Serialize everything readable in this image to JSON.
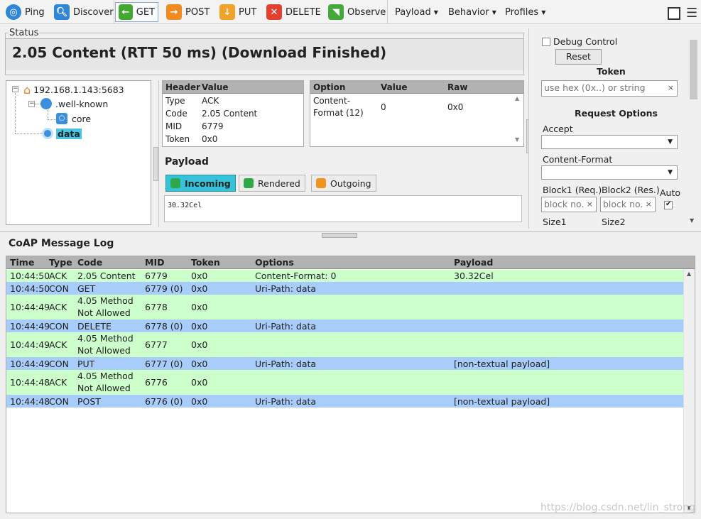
{
  "toolbar": {
    "ping": "Ping",
    "discover": "Discover",
    "get": "GET",
    "post": "POST",
    "put": "PUT",
    "delete": "DELETE",
    "observe": "Observe",
    "menus": {
      "payload": "Payload",
      "behavior": "Behavior",
      "profiles": "Profiles"
    }
  },
  "status": {
    "legend": "Status",
    "text": "2.05 Content (RTT 50 ms) (Download Finished)"
  },
  "tree": {
    "root": "192.168.1.143:5683",
    "well_known": ".well-known",
    "core": "core",
    "data": "data"
  },
  "header_table": {
    "col_header": "Header",
    "col_value": "Value",
    "rows": [
      {
        "k": "Type",
        "v": "ACK"
      },
      {
        "k": "Code",
        "v": "2.05 Content"
      },
      {
        "k": "MID",
        "v": "6779"
      },
      {
        "k": "Token",
        "v": "0x0"
      }
    ]
  },
  "option_table": {
    "col_option": "Option",
    "col_value": "Value",
    "col_raw": "Raw",
    "row": {
      "option_line1": "Content-",
      "option_line2": "Format (12)",
      "value": "0",
      "raw": "0x0"
    }
  },
  "payload": {
    "title": "Payload",
    "tabs": {
      "incoming": "Incoming",
      "rendered": "Rendered",
      "outgoing": "Outgoing"
    },
    "content": "30.32Cel"
  },
  "right": {
    "debug_control": "Debug Control",
    "reset": "Reset",
    "token_label": "Token",
    "token_placeholder": "use hex (0x..) or string",
    "request_options": "Request Options",
    "accept": "Accept",
    "content_format": "Content-Format",
    "block1": "Block1 (Req.)",
    "block2": "Block2 (Res.)",
    "auto": "Auto",
    "block_placeholder": "block no.",
    "size1": "Size1",
    "size2": "Size2",
    "clear_glyph": "×"
  },
  "log": {
    "title": "CoAP Message Log",
    "columns": {
      "time": "Time",
      "type": "Type",
      "code": "Code",
      "mid": "MID",
      "token": "Token",
      "options": "Options",
      "payload": "Payload"
    },
    "rows": [
      {
        "time": "10:44:50",
        "type": "ACK",
        "code": "2.05 Content",
        "code2": "",
        "mid": "6779",
        "token": "0x0",
        "options": "Content-Format: 0",
        "payload": "30.32Cel"
      },
      {
        "time": "10:44:50",
        "type": "CON",
        "code": "GET",
        "code2": "",
        "mid": "6779 (0)",
        "token": "0x0",
        "options": "Uri-Path: data",
        "payload": ""
      },
      {
        "time": "10:44:49",
        "type": "ACK",
        "code": "4.05 Method",
        "code2": "Not Allowed",
        "mid": "6778",
        "token": "0x0",
        "options": "",
        "payload": ""
      },
      {
        "time": "10:44:49",
        "type": "CON",
        "code": "DELETE",
        "code2": "",
        "mid": "6778 (0)",
        "token": "0x0",
        "options": "Uri-Path: data",
        "payload": ""
      },
      {
        "time": "10:44:49",
        "type": "ACK",
        "code": "4.05 Method",
        "code2": "Not Allowed",
        "mid": "6777",
        "token": "0x0",
        "options": "",
        "payload": ""
      },
      {
        "time": "10:44:49",
        "type": "CON",
        "code": "PUT",
        "code2": "",
        "mid": "6777 (0)",
        "token": "0x0",
        "options": "Uri-Path: data",
        "payload": "[non-textual payload]"
      },
      {
        "time": "10:44:48",
        "type": "ACK",
        "code": "4.05 Method",
        "code2": "Not Allowed",
        "mid": "6776",
        "token": "0x0",
        "options": "",
        "payload": ""
      },
      {
        "time": "10:44:48",
        "type": "CON",
        "code": "POST",
        "code2": "",
        "mid": "6776 (0)",
        "token": "0x0",
        "options": "Uri-Path: data",
        "payload": "[non-textual payload]"
      }
    ]
  },
  "watermark": "https://blog.csdn.net/lin_strong",
  "colors": {
    "ack_row": "#ccffcc",
    "con_row": "#a8cdfb",
    "incoming_tab": "#36c2d8"
  }
}
